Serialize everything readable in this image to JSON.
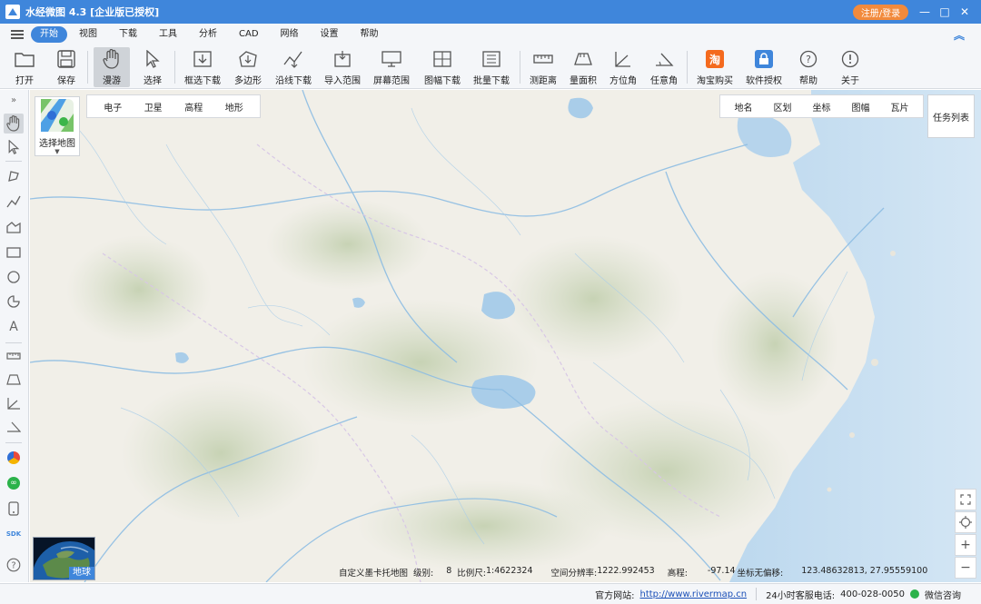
{
  "window": {
    "title": "水经微图 4.3 [企业版已授权]",
    "login_label": "注册/登录",
    "minimize": "—",
    "maximize": "□",
    "close": "✕"
  },
  "menu": {
    "items": [
      "开始",
      "视图",
      "下载",
      "工具",
      "分析",
      "CAD",
      "网络",
      "设置",
      "帮助"
    ],
    "active": "开始"
  },
  "toolbar": {
    "open": "打开",
    "save": "保存",
    "pan": "漫游",
    "select": "选择",
    "box_download": "框选下载",
    "polygon": "多边形",
    "line_download": "沿线下载",
    "import_range": "导入范围",
    "screen_range": "屏幕范围",
    "sheet_download": "图幅下载",
    "batch_download": "批量下载",
    "measure_distance": "测距离",
    "measure_area": "量面积",
    "azimuth": "方位角",
    "any_angle": "任意角",
    "taobao": "淘宝购买",
    "license": "软件授权",
    "help": "帮助",
    "about": "关于",
    "taobao_glyph": "淘"
  },
  "map": {
    "map_type_label": "选择地图",
    "layer_tabs": [
      "电子",
      "卫星",
      "高程",
      "地形"
    ],
    "overlay_tabs": [
      "地名",
      "区划",
      "坐标",
      "图幅",
      "瓦片"
    ],
    "task_list": "任务列表",
    "earth_label": "地球",
    "info": {
      "map_name": "自定义墨卡托地图",
      "level_label": "级别:",
      "level": "8",
      "scale_label": "比例尺:",
      "scale": "1:4622324",
      "resolution_label": "空间分辨率:",
      "resolution": "1222.992453",
      "elevation_label": "高程:",
      "elevation": "-97.14",
      "offset_label": "坐标无偏移:",
      "coords": "123.48632813, 27.95559100"
    },
    "left_tool_sdk": "SDK"
  },
  "statusbar": {
    "website_label": "官方网站:",
    "website": "http://www.rivermap.cn",
    "phone_label": "24小时客服电话:",
    "phone": "400-028-0050",
    "wechat": "微信咨询"
  },
  "colors": {
    "accent": "#3f86db",
    "login": "#f28a3b",
    "water": "#a9cde9",
    "land": "#f1efe8"
  }
}
